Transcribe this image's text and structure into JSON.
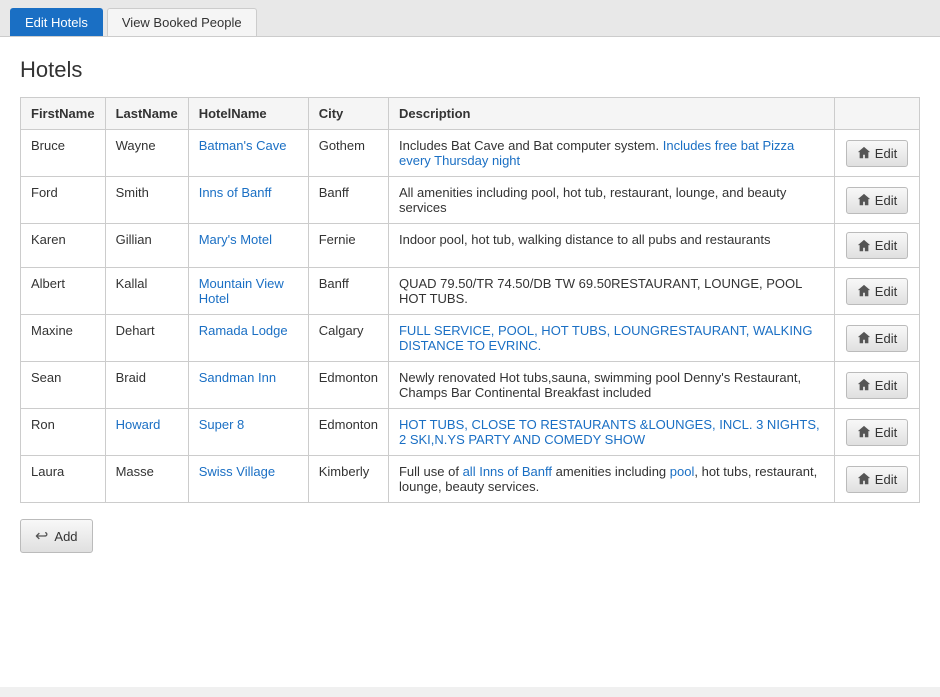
{
  "tabs": [
    {
      "id": "edit-hotels",
      "label": "Edit Hotels",
      "active": true
    },
    {
      "id": "view-booked",
      "label": "View Booked People",
      "active": false
    }
  ],
  "page": {
    "title": "Hotels"
  },
  "table": {
    "columns": [
      "FirstName",
      "LastName",
      "HotelName",
      "City",
      "Description"
    ],
    "rows": [
      {
        "firstname": "Bruce",
        "lastname": "Wayne",
        "hotelname": "Batman's Cave",
        "city": "Gothem",
        "description": "Includes Bat Cave and Bat computer system. Includes free bat Pizza every Thursday night",
        "desc_highlight_parts": [
          "Includes free bat Pizza every Thursday night"
        ]
      },
      {
        "firstname": "Ford",
        "lastname": "Smith",
        "hotelname": "Inns of Banff",
        "city": "Banff",
        "description": "All amenities including pool, hot tub, restaurant, lounge, and beauty services",
        "desc_highlight_parts": []
      },
      {
        "firstname": "Karen",
        "lastname": "Gillian",
        "hotelname": "Mary's Motel",
        "city": "Fernie",
        "description": "Indoor pool, hot tub, walking distance to all pubs and restaurants",
        "desc_highlight_parts": []
      },
      {
        "firstname": "Albert",
        "lastname": "Kallal",
        "hotelname": "Mountain View Hotel",
        "city": "Banff",
        "description": "QUAD 79.50/TR 74.50/DB TW 69.50RESTAURANT, LOUNGE, POOL HOT TUBS.",
        "desc_highlight_parts": []
      },
      {
        "firstname": "Maxine",
        "lastname": "Dehart",
        "hotelname": "Ramada Lodge",
        "city": "Calgary",
        "description": "FULL SERVICE, POOL, HOT TUBS, LOUNGRESTAURANT, WALKING DISTANCE TO EVRINC.",
        "desc_highlight_parts": [
          "FULL SERVICE, POOL, HOT TUBS, LOUNGRESTAURANT, WALKING DISTANCE TO EVRINC."
        ]
      },
      {
        "firstname": "Sean",
        "lastname": "Braid",
        "hotelname": "Sandman Inn",
        "city": "Edmonton",
        "description": "Newly renovated Hot tubs,sauna, swimming pool Denny's Restaurant, Champs Bar Continental Breakfast included",
        "desc_highlight_parts": []
      },
      {
        "firstname": "Ron",
        "lastname": "Howard",
        "hotelname": "Super 8",
        "city": "Edmonton",
        "description": "HOT TUBS, CLOSE TO RESTAURANTS &LOUNGES, INCL. 3 NIGHTS, 2 SKI,N.YS PARTY AND COMEDY SHOW",
        "desc_highlight_parts": [
          "HOT TUBS, CLOSE TO RESTAURANTS &LOUNGES, INCL. 3 NIGHTS, 2 SKI,N.YS PARTY AND COMEDY SHOW"
        ]
      },
      {
        "firstname": "Laura",
        "lastname": "Masse",
        "hotelname": "Swiss Village",
        "city": "Kimberly",
        "description": "Full use of all Inns of Banff amenities including pool, hot tubs, restaurant, lounge, beauty services.",
        "desc_highlight_parts": []
      }
    ],
    "edit_label": "Edit",
    "edit_button_aria": "Edit row"
  },
  "add_button": {
    "label": "Add"
  }
}
